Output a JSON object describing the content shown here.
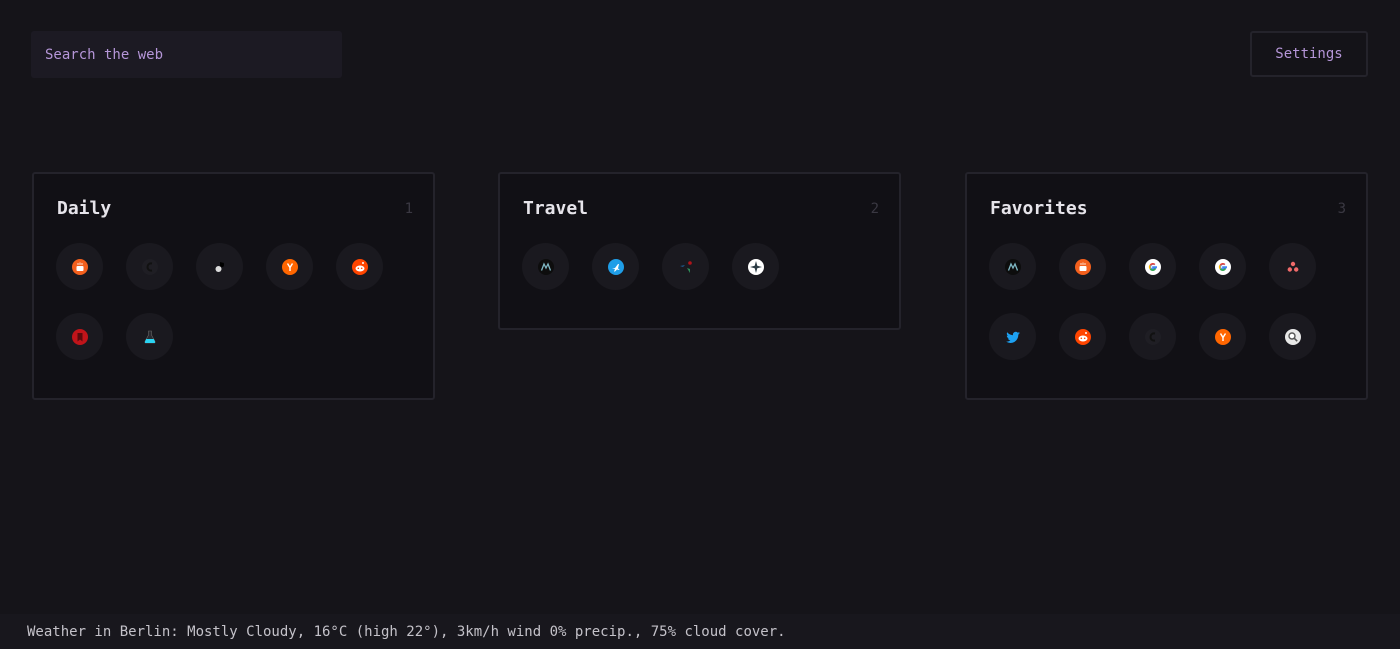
{
  "search": {
    "placeholder": "Search the web"
  },
  "settings": {
    "label": "Settings"
  },
  "groups": [
    {
      "title": "Daily",
      "number": "1",
      "items": [
        {
          "name": "coffee-app",
          "icon": "coffee-cup-icon",
          "bg": "#f4601d"
        },
        {
          "name": "dark-logo-site",
          "icon": "dark-letter-icon",
          "bg": "#1f1e24"
        },
        {
          "name": "spy-site",
          "icon": "spy-figure-icon",
          "bg": "#2a2a2a"
        },
        {
          "name": "hacker-news",
          "icon": "y-combinator-icon",
          "bg": "#ff6600"
        },
        {
          "name": "reddit",
          "icon": "reddit-alien-icon",
          "bg": "#ff4500"
        },
        {
          "name": "bookmark-site",
          "icon": "red-bookmark-icon",
          "bg": "#c0141a"
        },
        {
          "name": "lab-flask-site",
          "icon": "flask-icon",
          "bg": "#2ad3f2"
        }
      ]
    },
    {
      "title": "Travel",
      "number": "2",
      "items": [
        {
          "name": "mountain-logo-site",
          "icon": "mountain-m-icon",
          "bg": "#0d0d0d"
        },
        {
          "name": "flight-site",
          "icon": "airplane-icon",
          "bg": "#1f9ee8"
        },
        {
          "name": "arrows-site",
          "icon": "triangle-arrows-icon",
          "bg": "#1a191f"
        },
        {
          "name": "compass-site",
          "icon": "compass-icon",
          "bg": "#ffffff"
        }
      ]
    },
    {
      "title": "Favorites",
      "number": "3",
      "items": [
        {
          "name": "mountain-logo-site",
          "icon": "mountain-m-icon",
          "bg": "#0d0d0d"
        },
        {
          "name": "coffee-app",
          "icon": "coffee-cup-icon",
          "bg": "#f4601d"
        },
        {
          "name": "google",
          "icon": "google-g-icon",
          "bg": "#ffffff"
        },
        {
          "name": "google",
          "icon": "google-g-icon",
          "bg": "#ffffff"
        },
        {
          "name": "asana",
          "icon": "three-dots-icon",
          "bg": "#1a191f"
        },
        {
          "name": "twitter",
          "icon": "twitter-bird-icon",
          "bg": "#1da1f2"
        },
        {
          "name": "reddit",
          "icon": "reddit-alien-icon",
          "bg": "#ff4500"
        },
        {
          "name": "dark-logo-site",
          "icon": "dark-letter-icon",
          "bg": "#1f1e24"
        },
        {
          "name": "hacker-news",
          "icon": "y-combinator-icon",
          "bg": "#ff6600"
        },
        {
          "name": "search-site",
          "icon": "magnifier-icon",
          "bg": "#e8e8e8"
        }
      ]
    }
  ],
  "footer": {
    "weather": "Weather in Berlin: Mostly Cloudy, 16°C (high 22°), 3km/h wind 0% precip., 75% cloud cover."
  }
}
